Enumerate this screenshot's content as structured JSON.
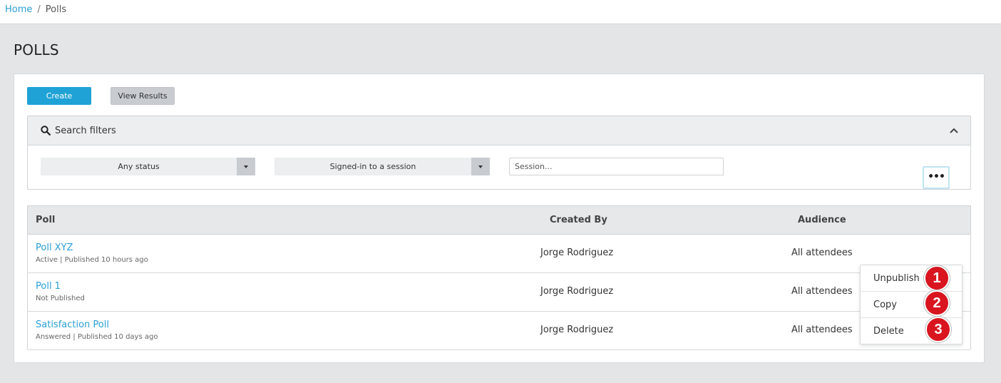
{
  "breadcrumb": {
    "home": "Home",
    "separator": "/",
    "current": "Polls"
  },
  "page": {
    "title": "POLLS"
  },
  "actions": {
    "create_label": "Create",
    "view_results_label": "View Results"
  },
  "filters": {
    "title": "Search filters",
    "status_select": "Any status",
    "signin_select": "Signed-in to a session",
    "session_placeholder": "Session..."
  },
  "table": {
    "headers": {
      "poll": "Poll",
      "created_by": "Created By",
      "audience": "Audience"
    },
    "rows": [
      {
        "name": "Poll XYZ",
        "sub": "Active | Published 10 hours ago",
        "created_by": "Jorge Rodriguez",
        "audience": "All attendees"
      },
      {
        "name": "Poll 1",
        "sub": "Not Published",
        "created_by": "Jorge Rodriguez",
        "audience": "All attendees"
      },
      {
        "name": "Satisfaction Poll",
        "sub": "Answered | Published 10 days ago",
        "created_by": "Jorge Rodriguez",
        "audience": "All attendees"
      }
    ]
  },
  "row_menu": {
    "trigger": "•••",
    "items": [
      "Unpublish",
      "Copy",
      "Delete"
    ]
  },
  "callouts": [
    "1",
    "2",
    "3"
  ],
  "colors": {
    "accent": "#1fa2d6",
    "link": "#2a9fd6",
    "callout": "#d9151f"
  }
}
